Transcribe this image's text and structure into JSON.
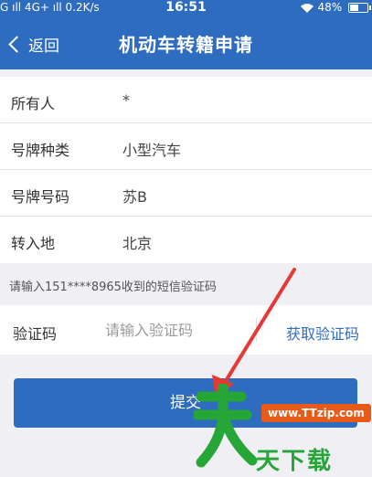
{
  "status_bar": {
    "left_text": "G ıll 4G+ ıll 0.2K/s",
    "time": "16:51",
    "battery": "48%"
  },
  "nav": {
    "back_label": "返回",
    "title": "机动车转籍申请"
  },
  "form": {
    "rows": [
      {
        "label": "所有人",
        "value": "*"
      },
      {
        "label": "号牌种类",
        "value": "小型汽车"
      },
      {
        "label": "号牌号码",
        "value": "苏B"
      },
      {
        "label": "转入地",
        "value": "北京"
      }
    ]
  },
  "sms": {
    "hint": "请输入151****8965收到的短信验证码",
    "code_label": "验证码",
    "code_placeholder": "请输入验证码",
    "code_value": "",
    "get_code_label": "获取验证码"
  },
  "submit_label": "提交",
  "watermark": {
    "url": "www.TTzip.com",
    "text": "天下载",
    "colors": {
      "green": "#26a637",
      "orange": "#e85a1a"
    }
  },
  "colors": {
    "primary": "#2e6cc0",
    "background": "#efeff4",
    "annotation_arrow": "#e53935"
  }
}
